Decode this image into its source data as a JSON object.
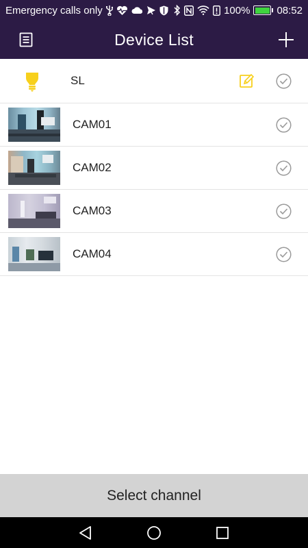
{
  "status_bar": {
    "carrier_text": "Emergency calls only",
    "battery_percent": "100%",
    "time": "08:52",
    "icons_left": [
      "usb-icon",
      "heart-monitor-icon",
      "cloud-icon",
      "send-icon",
      "shield-icon"
    ],
    "icons_right": [
      "bluetooth-icon",
      "nfc-icon",
      "wifi-icon",
      "vibrate-icon",
      "battery-icon"
    ]
  },
  "header": {
    "title": "Device List",
    "menu_icon": "document-list-icon",
    "add_icon": "plus-icon",
    "background_color": "#2c1b45"
  },
  "devices": [
    {
      "name": "SL",
      "type": "smart-light",
      "icon": "bulb-icon",
      "editable": true,
      "selected": false
    },
    {
      "name": "CAM01",
      "type": "camera",
      "thumbnail": "camera-thumbnail",
      "selected": false
    },
    {
      "name": "CAM02",
      "type": "camera",
      "thumbnail": "camera-thumbnail",
      "selected": false
    },
    {
      "name": "CAM03",
      "type": "camera",
      "thumbnail": "camera-thumbnail",
      "selected": false
    },
    {
      "name": "CAM04",
      "type": "camera",
      "thumbnail": "camera-thumbnail",
      "selected": false
    }
  ],
  "footer": {
    "select_channel_label": "Select channel"
  },
  "nav_bar": {
    "buttons": [
      "back-icon",
      "home-icon",
      "recent-apps-icon"
    ]
  },
  "colors": {
    "accent_yellow": "#f7d01c",
    "check_gray": "#9a9a9a",
    "battery_green": "#3fd43f"
  }
}
